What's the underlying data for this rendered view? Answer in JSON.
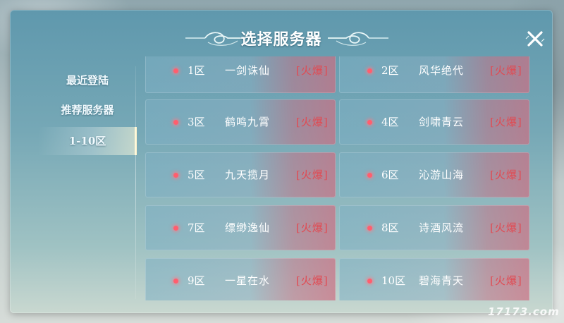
{
  "dialog": {
    "title": "选择服务器"
  },
  "sidebar": {
    "items": [
      {
        "label": "最近登陆",
        "active": false
      },
      {
        "label": "推荐服务器",
        "active": false
      },
      {
        "label": "1-10区",
        "active": true
      }
    ]
  },
  "servers": [
    {
      "zone": "1区",
      "name": "一剑诛仙",
      "status": "[火爆]"
    },
    {
      "zone": "2区",
      "name": "风华绝代",
      "status": "[火爆]"
    },
    {
      "zone": "3区",
      "name": "鹤鸣九霄",
      "status": "[火爆]"
    },
    {
      "zone": "4区",
      "name": "剑啸青云",
      "status": "[火爆]"
    },
    {
      "zone": "5区",
      "name": "九天揽月",
      "status": "[火爆]"
    },
    {
      "zone": "6区",
      "name": "沁游山海",
      "status": "[火爆]"
    },
    {
      "zone": "7区",
      "name": "缥缈逸仙",
      "status": "[火爆]"
    },
    {
      "zone": "8区",
      "name": "诗酒风流",
      "status": "[火爆]"
    },
    {
      "zone": "9区",
      "name": "一星在水",
      "status": "[火爆]"
    },
    {
      "zone": "10区",
      "name": "碧海青天",
      "status": "[火爆]"
    }
  ],
  "icons": {
    "close": "close-icon",
    "status_dot": "status-dot-icon",
    "title_ornament": "cloud-ornament-icon"
  },
  "colors": {
    "status_hot": "#e14a52",
    "dot": "#ff5e6e"
  },
  "watermark": {
    "text": "17173.com"
  }
}
